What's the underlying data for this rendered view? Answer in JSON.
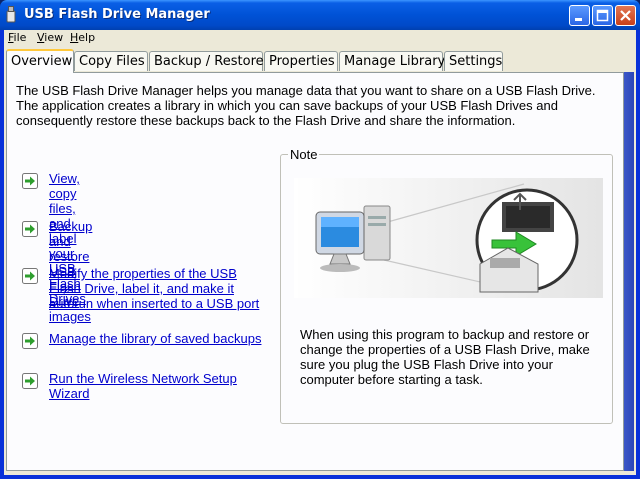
{
  "window": {
    "title": "USB Flash Drive Manager"
  },
  "menu": [
    {
      "label": "File",
      "mnemonic": "F",
      "rest": "ile"
    },
    {
      "label": "View",
      "mnemonic": "V",
      "rest": "iew"
    },
    {
      "label": "Help",
      "mnemonic": "H",
      "rest": "elp"
    }
  ],
  "tabs": [
    {
      "label": "Overview",
      "active": true
    },
    {
      "label": "Copy Files",
      "active": false
    },
    {
      "label": "Backup / Restore",
      "active": false
    },
    {
      "label": "Properties",
      "active": false
    },
    {
      "label": "Manage Library",
      "active": false
    },
    {
      "label": "Settings",
      "active": false
    }
  ],
  "overview": {
    "intro": "The USB Flash Drive Manager helps you manage data that you want to share on a USB Flash Drive. The application creates a library in which you can save backups of your USB Flash Drives and consequently restore these backups back to the Flash Drive and share the information.",
    "links": [
      {
        "line1": "View, copy files, and label your USB",
        "line2": "Flash Drives",
        "line3": ""
      },
      {
        "line1": "Backup and restore USB Flash Drive",
        "line2": "images",
        "line3": ""
      },
      {
        "line1": "Modify the properties of the USB",
        "line2": "Flash Drive, label it, and make it",
        "line3": "autorun when inserted to a USB port"
      },
      {
        "line1": "Manage the library of saved backups",
        "line2": "",
        "line3": ""
      },
      {
        "line1": "Run the Wireless Network Setup",
        "line2": "Wizard",
        "line3": ""
      }
    ],
    "note": {
      "label": "Note",
      "text": "When using this program to backup and restore or change the properties of a USB Flash Drive, make sure you plug the USB Flash Drive into your computer before starting a task."
    }
  },
  "colors": {
    "link": "#0000cc",
    "tab_active_accent": "#ffc83c",
    "titlebar": "#0052d6",
    "arrow_green": "#2e9e2e"
  }
}
